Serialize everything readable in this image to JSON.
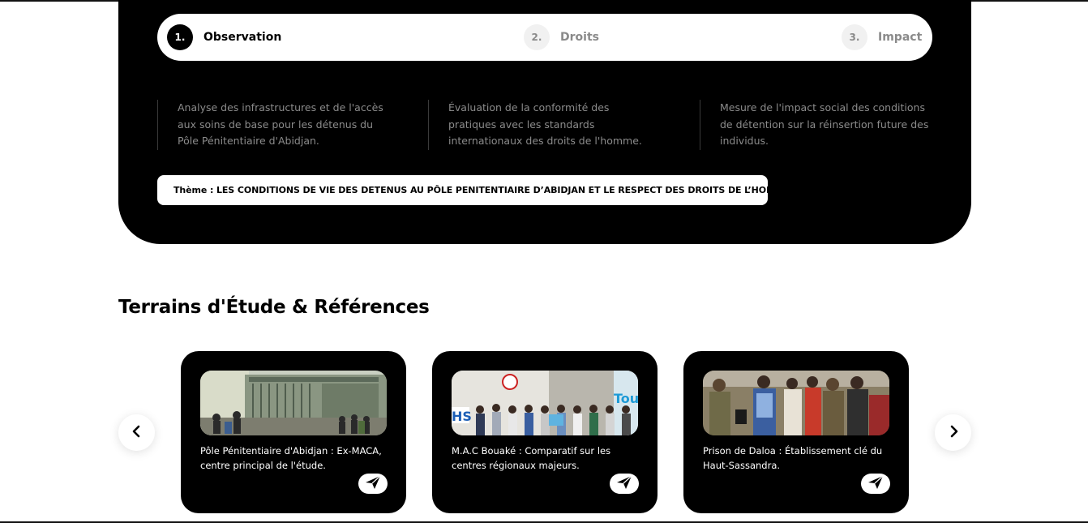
{
  "steps": [
    {
      "number": "1.",
      "label": "Observation",
      "active": true
    },
    {
      "number": "2.",
      "label": "Droits",
      "active": false
    },
    {
      "number": "3.",
      "label": "Impact",
      "active": false
    }
  ],
  "descriptions": [
    {
      "line1": "Analyse des infrastructures et de l'accès",
      "line2": "aux soins de base pour les détenus du",
      "line3": "Pôle Pénitentiaire d'Abidjan."
    },
    {
      "line1": "Évaluation de la conformité des",
      "line2": "pratiques avec les standards",
      "line3": "internationaux des droits de l'homme."
    },
    {
      "line1": "Mesure de l'impact social des conditions",
      "line2": "de détention sur la réinsertion future des",
      "line3": "individus."
    }
  ],
  "theme": {
    "text": "Thème : LES CONDITIONS DE VIE DES DETENUS AU PÔLE PENITENTIAIRE D’ABIDJAN ET LE RESPECT DES DROITS DE L’HOMME"
  },
  "section": {
    "title": "Terrains d'Étude & Références"
  },
  "cards": [
    {
      "line1": "Pôle Pénitentiaire d'Abidjan : Ex-MACA,",
      "line2": "centre principal de l'étude.",
      "icon": "send-icon"
    },
    {
      "line1": "M.A.C Bouaké : Comparatif sur les",
      "line2": "centres régionaux majeurs.",
      "icon": "send-icon"
    },
    {
      "line1": "Prison de Daloa : Établissement clé du",
      "line2": "Haut-Sassandra.",
      "icon": "send-icon"
    }
  ],
  "carousel": {
    "prev_icon": "chevron-left-icon",
    "next_icon": "chevron-right-icon"
  },
  "colors": {
    "panel": "#000000",
    "muted_text": "#8b8b8b",
    "inactive_step": "#8a8a8a"
  }
}
